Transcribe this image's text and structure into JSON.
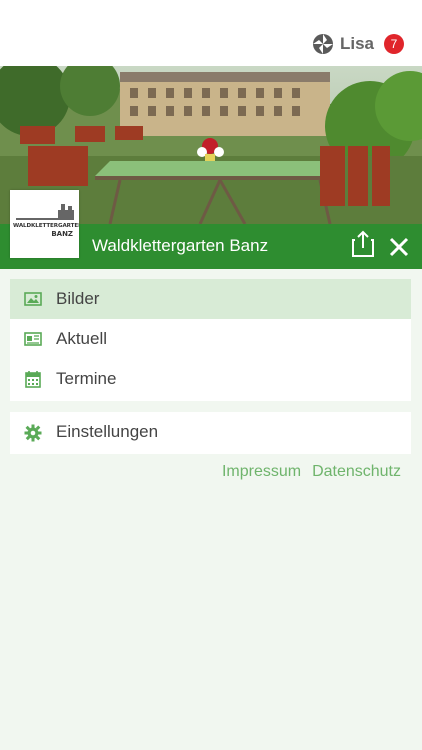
{
  "header": {
    "user_name": "Lisa",
    "notification_count": "7",
    "logo_icon": "app-logo-icon"
  },
  "hero": {
    "image_description_icon": "photo"
  },
  "club": {
    "title": "Waldklettergarten Banz",
    "logo_text": "WALDKLETTERGARTEN",
    "logo_subtext": "BANZ",
    "share_icon": "share-icon",
    "close_icon": "close-icon"
  },
  "menu": {
    "items": [
      {
        "label": "Bilder",
        "icon": "image-icon",
        "active": true
      },
      {
        "label": "Aktuell",
        "icon": "newspaper-icon",
        "active": false
      },
      {
        "label": "Termine",
        "icon": "calendar-icon",
        "active": false
      }
    ],
    "settings": {
      "label": "Einstellungen",
      "icon": "gear-icon"
    }
  },
  "footer": {
    "links": [
      "Impressum",
      "Datenschutz"
    ]
  },
  "colors": {
    "brand_green": "#2e8d30",
    "active_bg": "#d8ebd6",
    "link_green": "#6fb46c",
    "badge_red": "#e0252b",
    "page_bg": "#f1f7f0"
  }
}
